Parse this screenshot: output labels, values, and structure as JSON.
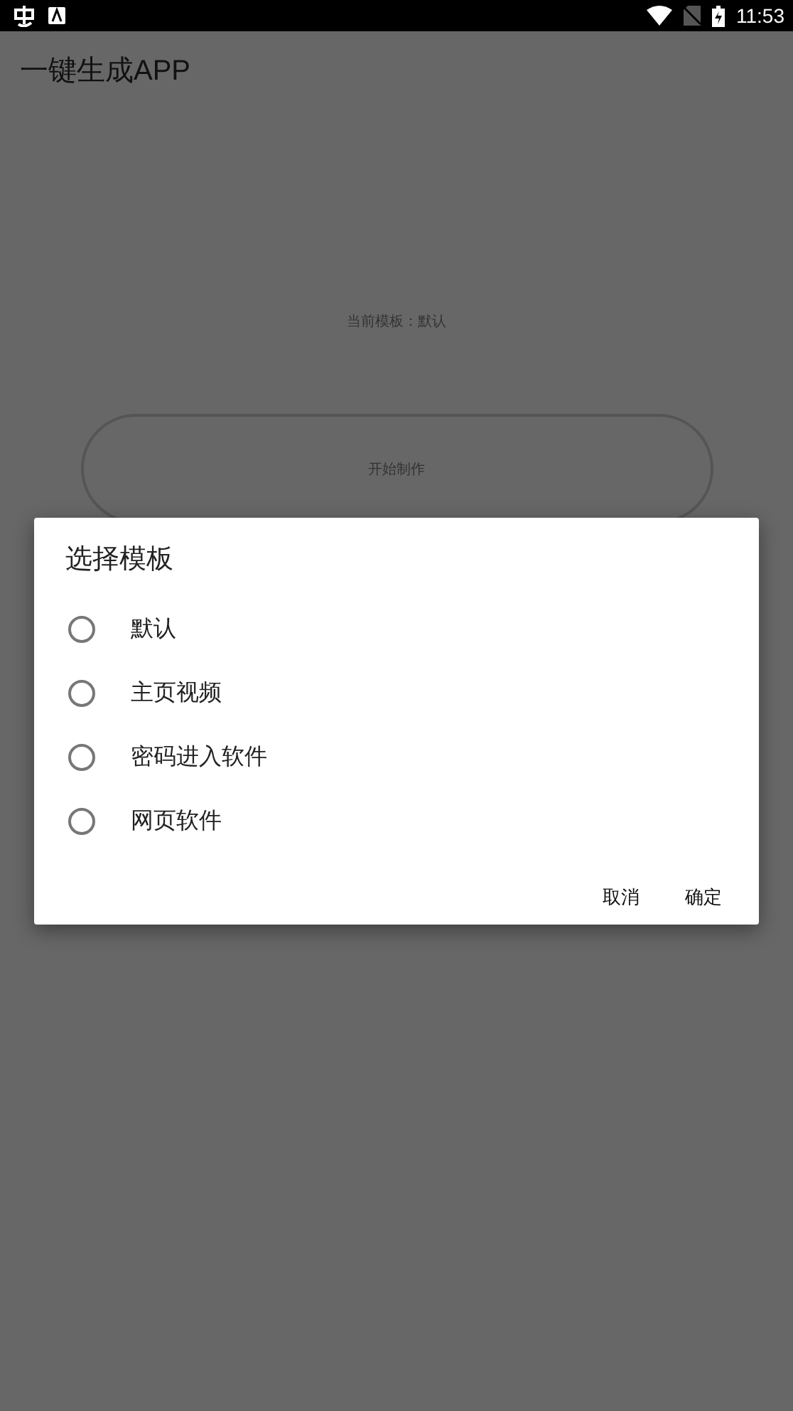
{
  "status_bar": {
    "time": "11:53"
  },
  "app_bar": {
    "title": "一键生成APP"
  },
  "current_template": "当前模板：默认",
  "start_button": "开始制作",
  "dialog": {
    "title": "选择模板",
    "options": [
      {
        "label": "默认",
        "selected": false
      },
      {
        "label": "主页视频",
        "selected": false
      },
      {
        "label": "密码进入软件",
        "selected": false
      },
      {
        "label": "网页软件",
        "selected": false
      }
    ],
    "buttons": [
      "取消",
      "确定"
    ]
  }
}
